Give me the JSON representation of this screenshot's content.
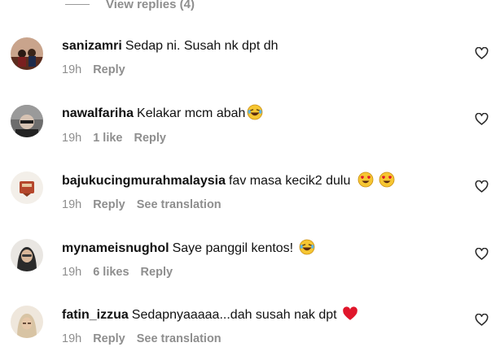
{
  "view_replies": "View replies (4)",
  "comments": [
    {
      "username": "sanizamri",
      "text": "Sedap ni. Susah nk dpt dh",
      "time": "19h",
      "reply": "Reply"
    },
    {
      "username": "nawalfariha",
      "text": "Kelakar mcm abah",
      "time": "19h",
      "likes": "1 like",
      "reply": "Reply",
      "emoji": "laughing-face"
    },
    {
      "username": "bajukucingmurahmalaysia",
      "text": "fav masa kecik2 dulu",
      "time": "19h",
      "reply": "Reply",
      "translate": "See translation",
      "emoji": "heart-eyes-face x2"
    },
    {
      "username": "mynameisnughol",
      "text": "Saye panggil kentos!",
      "time": "19h",
      "likes": "6 likes",
      "reply": "Reply",
      "emoji": "laughing-face"
    },
    {
      "username": "fatin_izzua",
      "text": "Sedapnyaaaaa...dah susah nak dpt",
      "time": "19h",
      "reply": "Reply",
      "translate": "See translation",
      "emoji": "red-heart"
    }
  ],
  "colors": {
    "secondary_text": "#8e8e8e",
    "primary_text": "#111111",
    "red_heart": "#e0162b"
  },
  "icons": {
    "like": "heart-outline-icon"
  }
}
